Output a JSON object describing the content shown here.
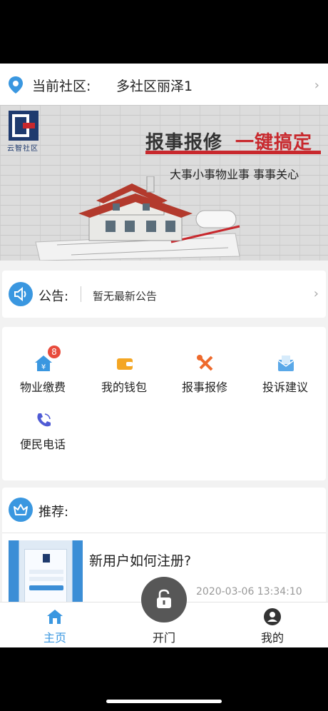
{
  "community": {
    "label": "当前社区:",
    "value": "多社区丽泽1",
    "icon": "location-pin-icon",
    "chevron": "›"
  },
  "banner": {
    "logo_text": "云智社区",
    "headline": "报事报修",
    "headline_highlight": "一键搞定",
    "subline": "大事小事物业事  事事关心",
    "accent_color": "#c8282d"
  },
  "notice": {
    "icon": "speaker-icon",
    "title": "公告:",
    "text": "暂无最新公告",
    "chevron": "›"
  },
  "services": [
    {
      "label": "物业缴费",
      "icon": "house-yen-icon",
      "badge": "8"
    },
    {
      "label": "我的钱包",
      "icon": "wallet-icon",
      "badge": null
    },
    {
      "label": "报事报修",
      "icon": "tools-icon",
      "badge": null
    },
    {
      "label": "投诉建议",
      "icon": "mail-icon",
      "badge": null
    },
    {
      "label": "便民电话",
      "icon": "phone-icon",
      "badge": null
    }
  ],
  "recommend": {
    "icon": "crown-icon",
    "title": "推荐:"
  },
  "article": {
    "title": "新用户如何注册?",
    "time": "2020-03-06 13:34:10"
  },
  "tabbar": {
    "home": {
      "label": "主页",
      "icon": "home-icon"
    },
    "open": {
      "label": "开门",
      "icon": "lock-icon"
    },
    "me": {
      "label": "我的",
      "icon": "user-icon"
    },
    "active_color": "#3a97e0"
  }
}
